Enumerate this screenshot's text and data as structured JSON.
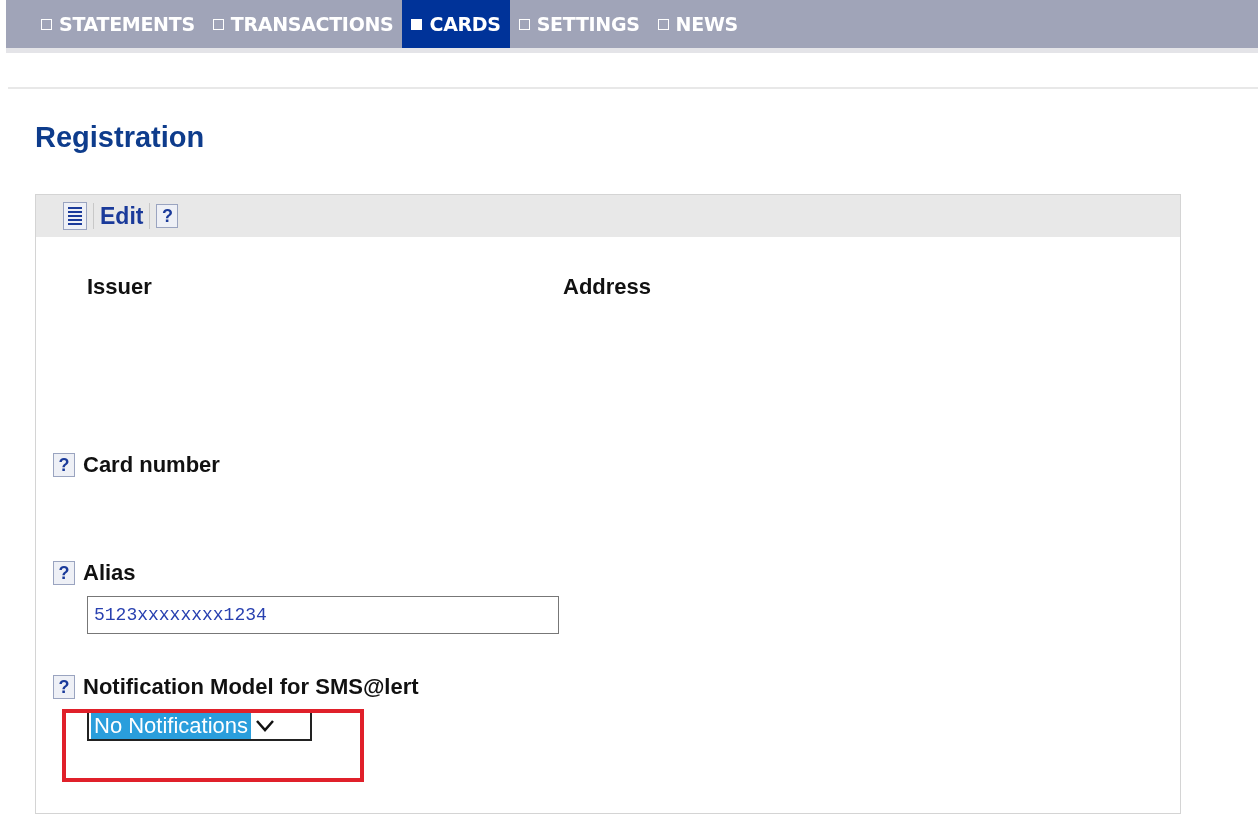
{
  "nav": {
    "tabs": [
      {
        "label": "STATEMENTS",
        "selected": false
      },
      {
        "label": "TRANSACTIONS",
        "selected": false
      },
      {
        "label": "CARDS",
        "selected": true
      },
      {
        "label": "SETTINGS",
        "selected": false
      },
      {
        "label": "NEWS",
        "selected": false
      }
    ]
  },
  "heading": "Registration",
  "toolbar": {
    "edit": "Edit",
    "help": "?"
  },
  "columns": [
    "Issuer",
    "Address"
  ],
  "fields": [
    {
      "kind": "text",
      "help": "?",
      "label": "Card number"
    },
    {
      "kind": "input",
      "help": "?",
      "label": "Alias",
      "value": "5123xxxxxxxx1234"
    },
    {
      "kind": "select",
      "help": "?",
      "label": "Notification Model for SMS@lert",
      "value": "No Notifications",
      "highlighted": true
    }
  ]
}
